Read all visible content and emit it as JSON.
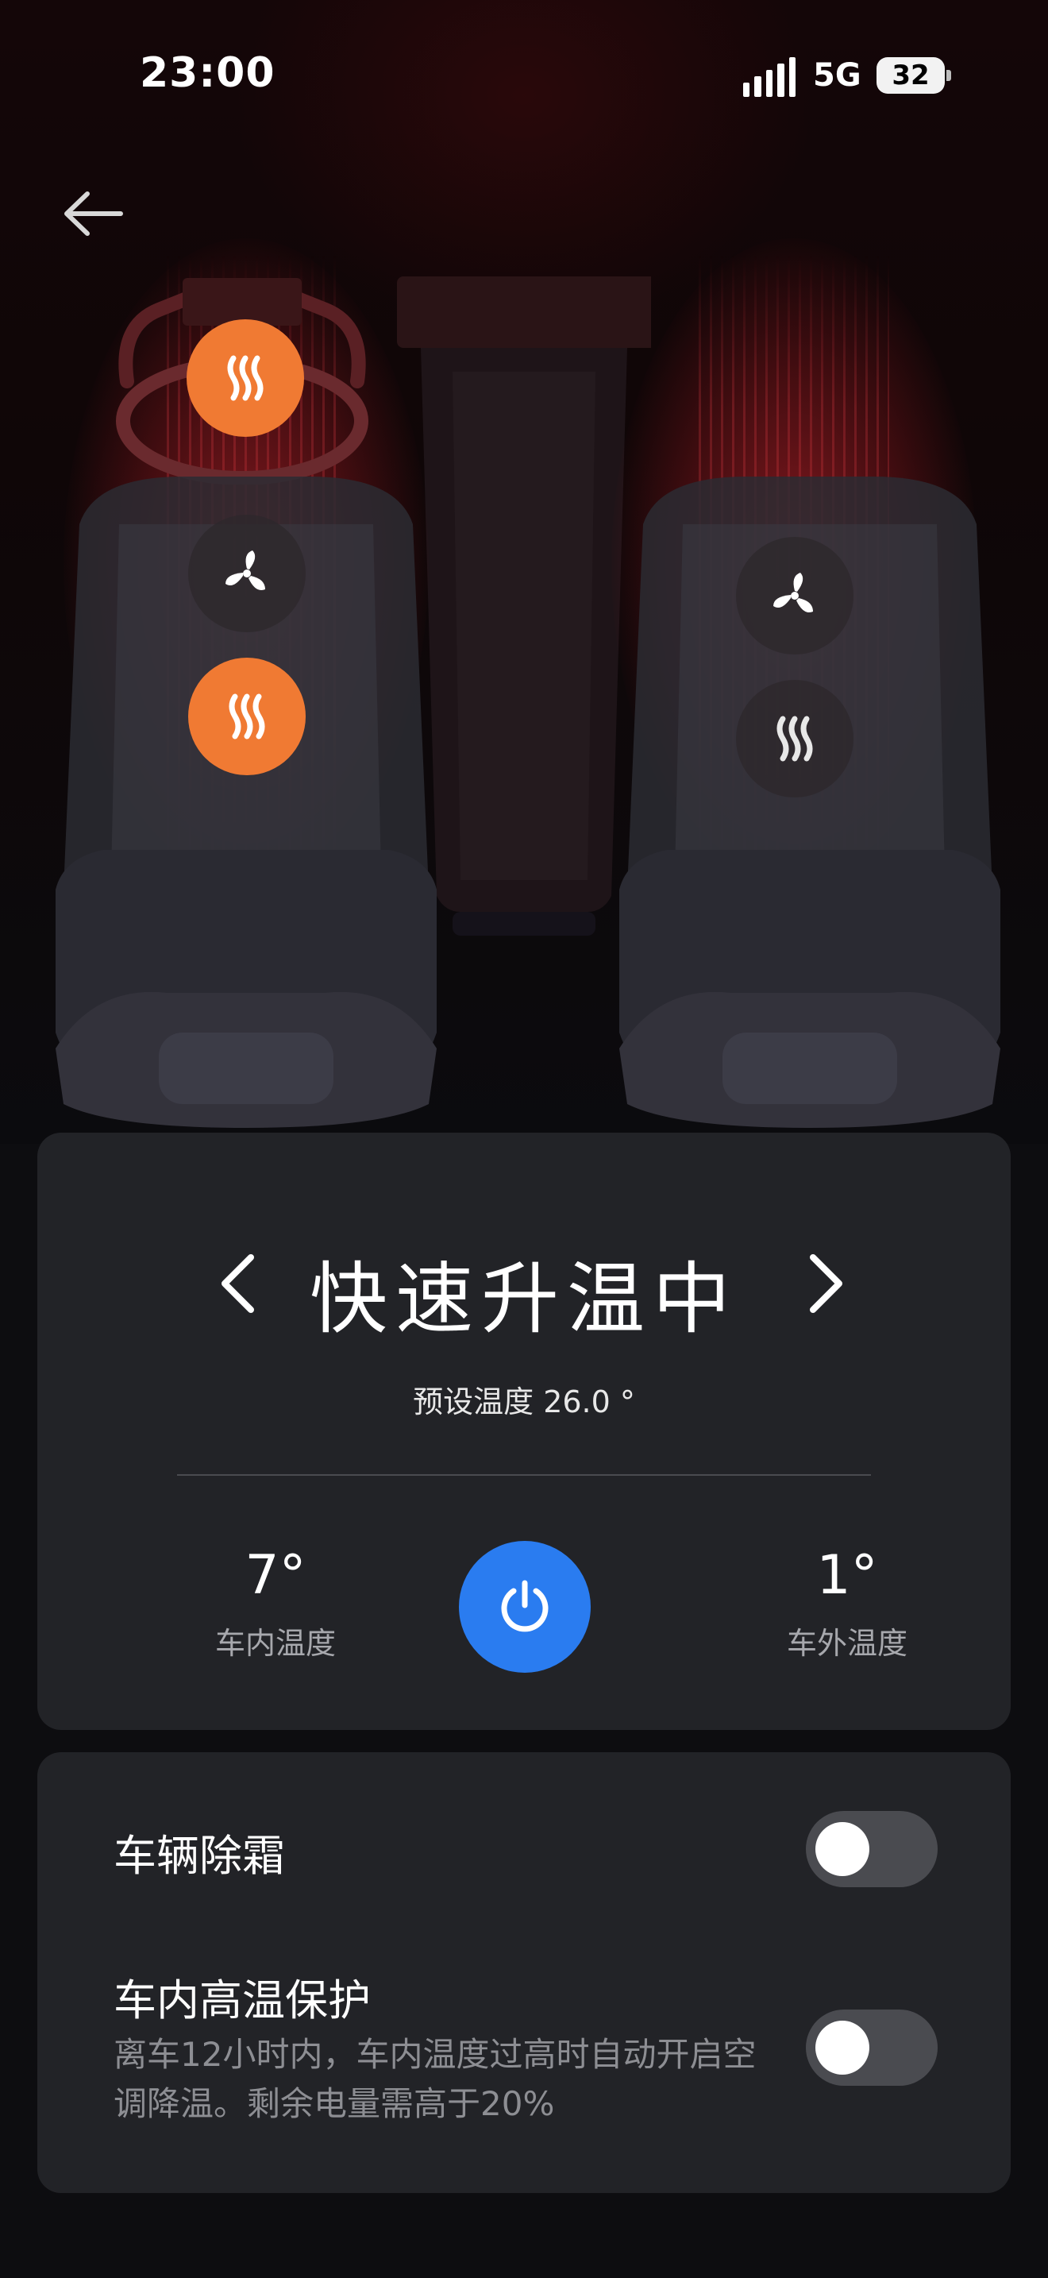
{
  "status_bar": {
    "time": "23:00",
    "network": "5G",
    "battery": "32"
  },
  "nav": {
    "back_icon": "arrow-left-icon"
  },
  "seat_controls": {
    "left": [
      {
        "name": "steering-wheel-heat",
        "icon": "heat-waves-icon",
        "active": true
      },
      {
        "name": "seat-ventilation",
        "icon": "fan-icon",
        "active": false
      },
      {
        "name": "seat-heat",
        "icon": "heat-waves-icon",
        "active": true
      }
    ],
    "right": [
      {
        "name": "seat-ventilation",
        "icon": "fan-icon",
        "active": false
      },
      {
        "name": "seat-heat",
        "icon": "heat-waves-icon",
        "active": false
      }
    ]
  },
  "climate": {
    "mode": "快速升温中",
    "preset": "预设温度 26.0 °",
    "inside_value": "7°",
    "inside_label": "车内温度",
    "outside_value": "1°",
    "outside_label": "车外温度",
    "power_icon": "power-icon"
  },
  "options": {
    "defrost_label": "车辆除霜",
    "defrost_on": false,
    "heat_protect_label": "车内高温保护",
    "heat_protect_desc": "离车12小时内，车内温度过高时自动开启空调降温。剩余电量需高于20%",
    "heat_protect_on": false
  },
  "colors": {
    "accent_orange": "#f07a33",
    "power_blue": "#2a7cf0",
    "card_bg": "#222327"
  }
}
